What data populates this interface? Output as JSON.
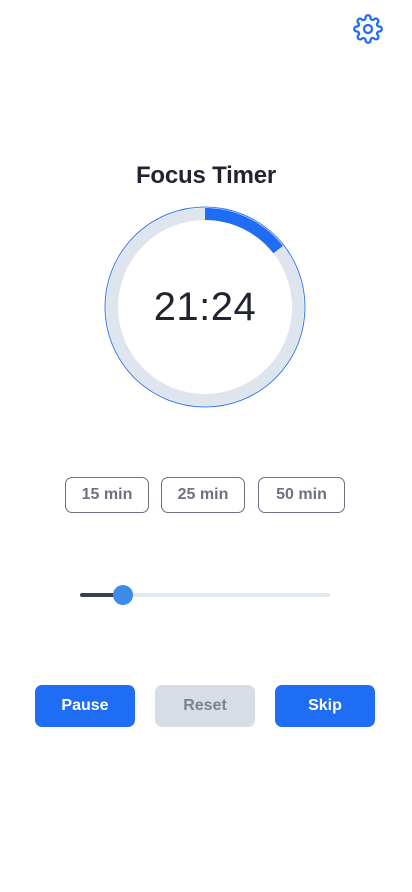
{
  "header": {
    "settings_icon": "gear-icon"
  },
  "timer": {
    "title": "Focus Timer",
    "time_remaining": "21:24",
    "progress_fraction": 0.144
  },
  "presets": [
    {
      "label": "15 min"
    },
    {
      "label": "25 min"
    },
    {
      "label": "50 min"
    }
  ],
  "slider": {
    "value_fraction": 0.17
  },
  "actions": {
    "pause_label": "Pause",
    "reset_label": "Reset",
    "skip_label": "Skip"
  },
  "colors": {
    "accent": "#1f6cf5",
    "ring_track": "#dee5ef",
    "ring_outline": "#3b78e7",
    "slider_thumb": "#3b8beb",
    "disabled_bg": "#d6dde6"
  }
}
